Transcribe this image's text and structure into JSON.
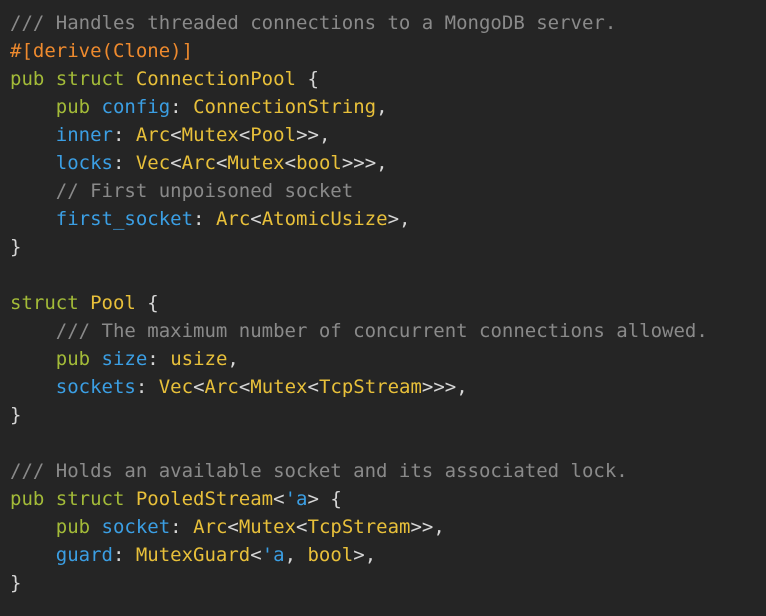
{
  "code": {
    "language": "rust",
    "lines": [
      [
        {
          "text": "/// Handles threaded connections to a MongoDB server.",
          "role": "comment"
        }
      ],
      [
        {
          "text": "#[derive(Clone)]",
          "role": "attr"
        }
      ],
      [
        {
          "text": "pub ",
          "role": "kw"
        },
        {
          "text": "struct ",
          "role": "kw"
        },
        {
          "text": "ConnectionPool",
          "role": "type"
        },
        {
          "text": " {",
          "role": "punct"
        }
      ],
      [
        {
          "text": "    ",
          "role": "punct"
        },
        {
          "text": "pub ",
          "role": "kw"
        },
        {
          "text": "config",
          "role": "field"
        },
        {
          "text": ": ",
          "role": "punct"
        },
        {
          "text": "ConnectionString",
          "role": "type"
        },
        {
          "text": ",",
          "role": "punct"
        }
      ],
      [
        {
          "text": "    ",
          "role": "punct"
        },
        {
          "text": "inner",
          "role": "field"
        },
        {
          "text": ": ",
          "role": "punct"
        },
        {
          "text": "Arc",
          "role": "type"
        },
        {
          "text": "<",
          "role": "punct"
        },
        {
          "text": "Mutex",
          "role": "type"
        },
        {
          "text": "<",
          "role": "punct"
        },
        {
          "text": "Pool",
          "role": "type"
        },
        {
          "text": ">>,",
          "role": "punct"
        }
      ],
      [
        {
          "text": "    ",
          "role": "punct"
        },
        {
          "text": "locks",
          "role": "field"
        },
        {
          "text": ": ",
          "role": "punct"
        },
        {
          "text": "Vec",
          "role": "type"
        },
        {
          "text": "<",
          "role": "punct"
        },
        {
          "text": "Arc",
          "role": "type"
        },
        {
          "text": "<",
          "role": "punct"
        },
        {
          "text": "Mutex",
          "role": "type"
        },
        {
          "text": "<",
          "role": "punct"
        },
        {
          "text": "bool",
          "role": "type"
        },
        {
          "text": ">>>,",
          "role": "punct"
        }
      ],
      [
        {
          "text": "    ",
          "role": "punct"
        },
        {
          "text": "// First unpoisoned socket",
          "role": "comment"
        }
      ],
      [
        {
          "text": "    ",
          "role": "punct"
        },
        {
          "text": "first_socket",
          "role": "field"
        },
        {
          "text": ": ",
          "role": "punct"
        },
        {
          "text": "Arc",
          "role": "type"
        },
        {
          "text": "<",
          "role": "punct"
        },
        {
          "text": "AtomicUsize",
          "role": "type"
        },
        {
          "text": ">,",
          "role": "punct"
        }
      ],
      [
        {
          "text": "}",
          "role": "punct"
        }
      ],
      [],
      [
        {
          "text": "struct ",
          "role": "kw"
        },
        {
          "text": "Pool",
          "role": "type"
        },
        {
          "text": " {",
          "role": "punct"
        }
      ],
      [
        {
          "text": "    ",
          "role": "punct"
        },
        {
          "text": "/// The maximum number of concurrent connections allowed.",
          "role": "comment"
        }
      ],
      [
        {
          "text": "    ",
          "role": "punct"
        },
        {
          "text": "pub ",
          "role": "kw"
        },
        {
          "text": "size",
          "role": "field"
        },
        {
          "text": ": ",
          "role": "punct"
        },
        {
          "text": "usize",
          "role": "type"
        },
        {
          "text": ",",
          "role": "punct"
        }
      ],
      [
        {
          "text": "    ",
          "role": "punct"
        },
        {
          "text": "sockets",
          "role": "field"
        },
        {
          "text": ": ",
          "role": "punct"
        },
        {
          "text": "Vec",
          "role": "type"
        },
        {
          "text": "<",
          "role": "punct"
        },
        {
          "text": "Arc",
          "role": "type"
        },
        {
          "text": "<",
          "role": "punct"
        },
        {
          "text": "Mutex",
          "role": "type"
        },
        {
          "text": "<",
          "role": "punct"
        },
        {
          "text": "TcpStream",
          "role": "type"
        },
        {
          "text": ">>>,",
          "role": "punct"
        }
      ],
      [
        {
          "text": "}",
          "role": "punct"
        }
      ],
      [],
      [
        {
          "text": "/// Holds an available socket and its associated lock.",
          "role": "comment"
        }
      ],
      [
        {
          "text": "pub ",
          "role": "kw"
        },
        {
          "text": "struct ",
          "role": "kw"
        },
        {
          "text": "PooledStream",
          "role": "type"
        },
        {
          "text": "<",
          "role": "punct"
        },
        {
          "text": "'a",
          "role": "field"
        },
        {
          "text": "> {",
          "role": "punct"
        }
      ],
      [
        {
          "text": "    ",
          "role": "punct"
        },
        {
          "text": "pub ",
          "role": "kw"
        },
        {
          "text": "socket",
          "role": "field"
        },
        {
          "text": ": ",
          "role": "punct"
        },
        {
          "text": "Arc",
          "role": "type"
        },
        {
          "text": "<",
          "role": "punct"
        },
        {
          "text": "Mutex",
          "role": "type"
        },
        {
          "text": "<",
          "role": "punct"
        },
        {
          "text": "TcpStream",
          "role": "type"
        },
        {
          "text": ">>,",
          "role": "punct"
        }
      ],
      [
        {
          "text": "    ",
          "role": "punct"
        },
        {
          "text": "guard",
          "role": "field"
        },
        {
          "text": ": ",
          "role": "punct"
        },
        {
          "text": "MutexGuard",
          "role": "type"
        },
        {
          "text": "<",
          "role": "punct"
        },
        {
          "text": "'a",
          "role": "field"
        },
        {
          "text": ", ",
          "role": "punct"
        },
        {
          "text": "bool",
          "role": "type"
        },
        {
          "text": ">,",
          "role": "punct"
        }
      ],
      [
        {
          "text": "}",
          "role": "punct"
        }
      ]
    ]
  },
  "colors": {
    "background": "#252525",
    "comment": "#8a8a8a",
    "attr": "#ee8a2e",
    "kw": "#a3bb38",
    "type": "#e8c03a",
    "field": "#3b9fe4",
    "punct": "#d6d6d6"
  }
}
